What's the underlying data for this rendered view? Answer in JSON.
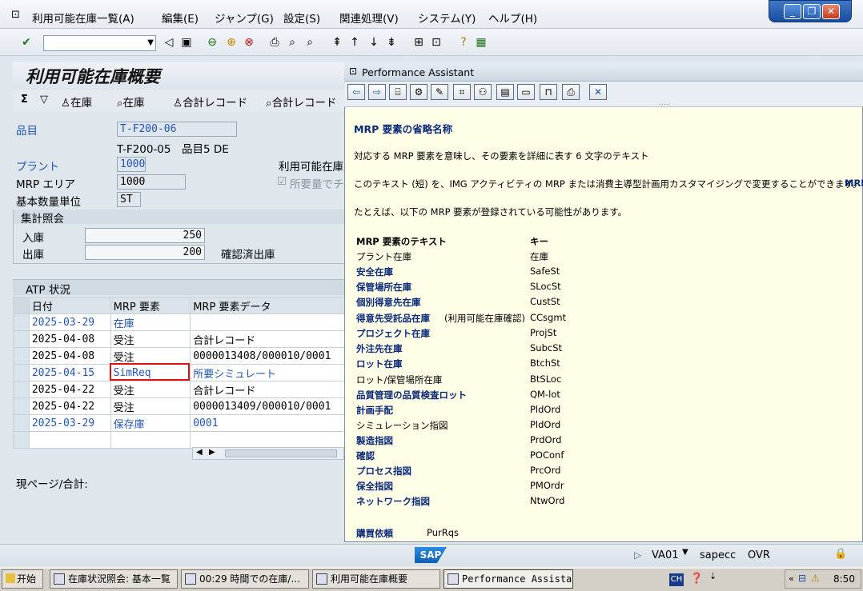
{
  "menubar": {
    "items": [
      "利用可能在庫一覧(A)",
      "編集(E)",
      "ジャンプ(G)",
      "設定(S)",
      "関連処理(V)",
      "システム(Y)",
      "ヘルプ(H)"
    ]
  },
  "page_title": "利用可能在庫概要",
  "app_toolbar": {
    "btn1": "在庫",
    "btn2": "在庫",
    "btn3": "合計レコード",
    "btn4": "合計レコード"
  },
  "header": {
    "material_label": "品目",
    "material_value": "T-F200-06",
    "material_desc": "T-F200-05　品目5 DE",
    "plant_label": "プラント",
    "plant_value": "1000",
    "mrp_area_label": "MRP エリア",
    "mrp_area_value": "1000",
    "base_unit_label": "基本数量単位",
    "base_unit_value": "ST",
    "available_label": "利用可能在庫",
    "checkbox_label": "所要量でチ"
  },
  "aggregate": {
    "title": "集計照会",
    "receipts_label": "入庫",
    "receipts_value": "250",
    "issues_label": "出庫",
    "issues_value": "200",
    "confirmed_label": "確認済出庫"
  },
  "atp": {
    "title": "ATP 状況",
    "columns": [
      "日付",
      "MRP 要素",
      "MRP 要素データ"
    ],
    "rows": [
      {
        "date": "2025-03-29",
        "element": "在庫",
        "data": ""
      },
      {
        "date": "2025-04-08",
        "element": "受注",
        "data": "合計レコード"
      },
      {
        "date": "2025-04-08",
        "element": "受注",
        "data": "0000013408/000010/0001"
      },
      {
        "date": "2025-04-15",
        "element": "SimReq",
        "data": "所要シミュレート"
      },
      {
        "date": "2025-04-22",
        "element": "受注",
        "data": "合計レコード"
      },
      {
        "date": "2025-04-22",
        "element": "受注",
        "data": "0000013409/000010/0001"
      },
      {
        "date": "2025-03-29",
        "element": "保存庫",
        "data": "0001"
      },
      {
        "date": "",
        "element": "",
        "data": ""
      }
    ]
  },
  "footer_text": "現ページ/合計:",
  "pa": {
    "title": "Performance Assistant",
    "heading": "MRP 要素の省略名称",
    "p1": "対応する MRP 要素を意味し、その要素を詳細に表す 6 文字のテキスト",
    "p2": "このテキスト (短) を、IMG アクティビティの MRP または消費主導型計画用カスタマイジングで変更することができます。",
    "p2_link": "MRP",
    "p3": "たとえば、以下の MRP 要素が登録されている可能性があります。",
    "col_text": "MRP 要素のテキスト",
    "col_key": "キー",
    "rows": [
      {
        "text": "プラント在庫",
        "key": "在庫",
        "bold": false
      },
      {
        "text": "安全在庫",
        "key": "SafeSt",
        "bold": true
      },
      {
        "text": "保管場所在庫",
        "key": "SLocSt",
        "bold": true
      },
      {
        "text": "個別得意先在庫",
        "key": "CustSt",
        "bold": true
      },
      {
        "text": "得意先受託品在庫",
        "suffix": "(利用可能在庫確認)",
        "key": "CCsgmt",
        "bold": true
      },
      {
        "text": "プロジェクト在庫",
        "key": "ProjSt",
        "bold": true
      },
      {
        "text": "外注先在庫",
        "key": "SubcSt",
        "bold": true
      },
      {
        "text": "ロット在庫",
        "key": "BtchSt",
        "bold": true
      },
      {
        "text": "ロット/保管場所在庫",
        "key": "BtSLoc",
        "bold": false
      },
      {
        "text": "品質管理の品質検査ロット",
        "key": "QM-lot",
        "bold": true
      },
      {
        "text": "計画手配",
        "key": "PldOrd",
        "bold": true
      },
      {
        "text": "シミュレーション指図",
        "key": "PldOrd",
        "bold": false
      },
      {
        "text": "製造指図",
        "key": "PrdOrd",
        "bold": true
      },
      {
        "text": "確認",
        "key": "POConf",
        "bold": true
      },
      {
        "text": "プロセス指図",
        "key": "PrcOrd",
        "bold": true
      },
      {
        "text": "保全指図",
        "key": "PMOrdr",
        "bold": true
      },
      {
        "text": "ネットワーク指図",
        "key": "NtwOrd",
        "bold": true
      }
    ],
    "last_text": "購買依頼",
    "last_key": "PurRqs"
  },
  "status": {
    "logo": "SAP",
    "tcode": "VA01",
    "server": "sapecc",
    "mode": "OVR"
  },
  "taskbar": {
    "start": "开始",
    "tasks": [
      "在庫状況照会: 基本一覧",
      "00:29 時間での在庫/...",
      "利用可能在庫概要",
      "Performance Assistant"
    ],
    "lang": "CH",
    "time": "8:50"
  }
}
